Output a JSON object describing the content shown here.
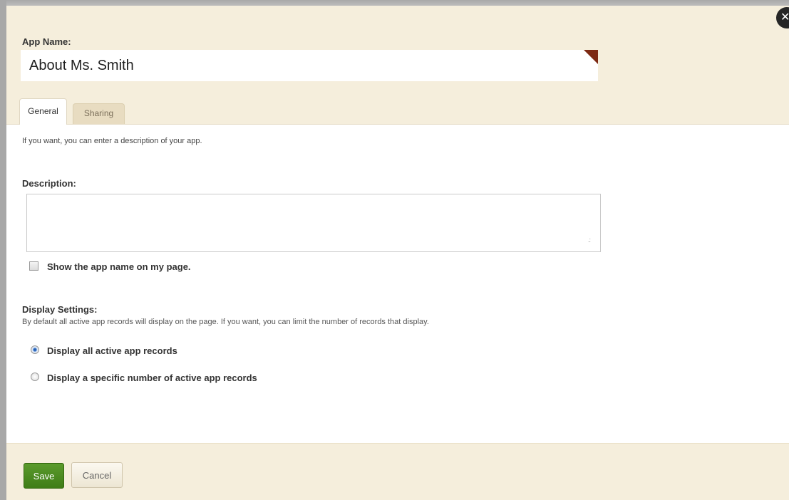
{
  "header": {
    "app_name_label": "App Name:",
    "app_name_value": "About Ms. Smith",
    "close_glyph": "✕",
    "corner_flag_color": "#7d2a14"
  },
  "tabs": [
    {
      "label": "General",
      "active": true
    },
    {
      "label": "Sharing",
      "active": false
    }
  ],
  "general": {
    "intro": "If you want, you can enter a description of your app.",
    "description_label": "Description:",
    "description_value": "",
    "show_name_label": "Show the app name on my page.",
    "show_name_checked": false,
    "display_settings_label": "Display Settings:",
    "display_settings_desc": "By default all active app records will display on the page. If you want, you can limit the number of records that display.",
    "radio_options": [
      {
        "label": "Display all active app records",
        "checked": true
      },
      {
        "label": "Display a specific number of active app records",
        "checked": false
      }
    ]
  },
  "footer": {
    "save_label": "Save",
    "cancel_label": "Cancel"
  },
  "colors": {
    "header_bg": "#f5eedc",
    "save_green": "#3f7d17",
    "tab_inactive": "#e8dcc1"
  }
}
